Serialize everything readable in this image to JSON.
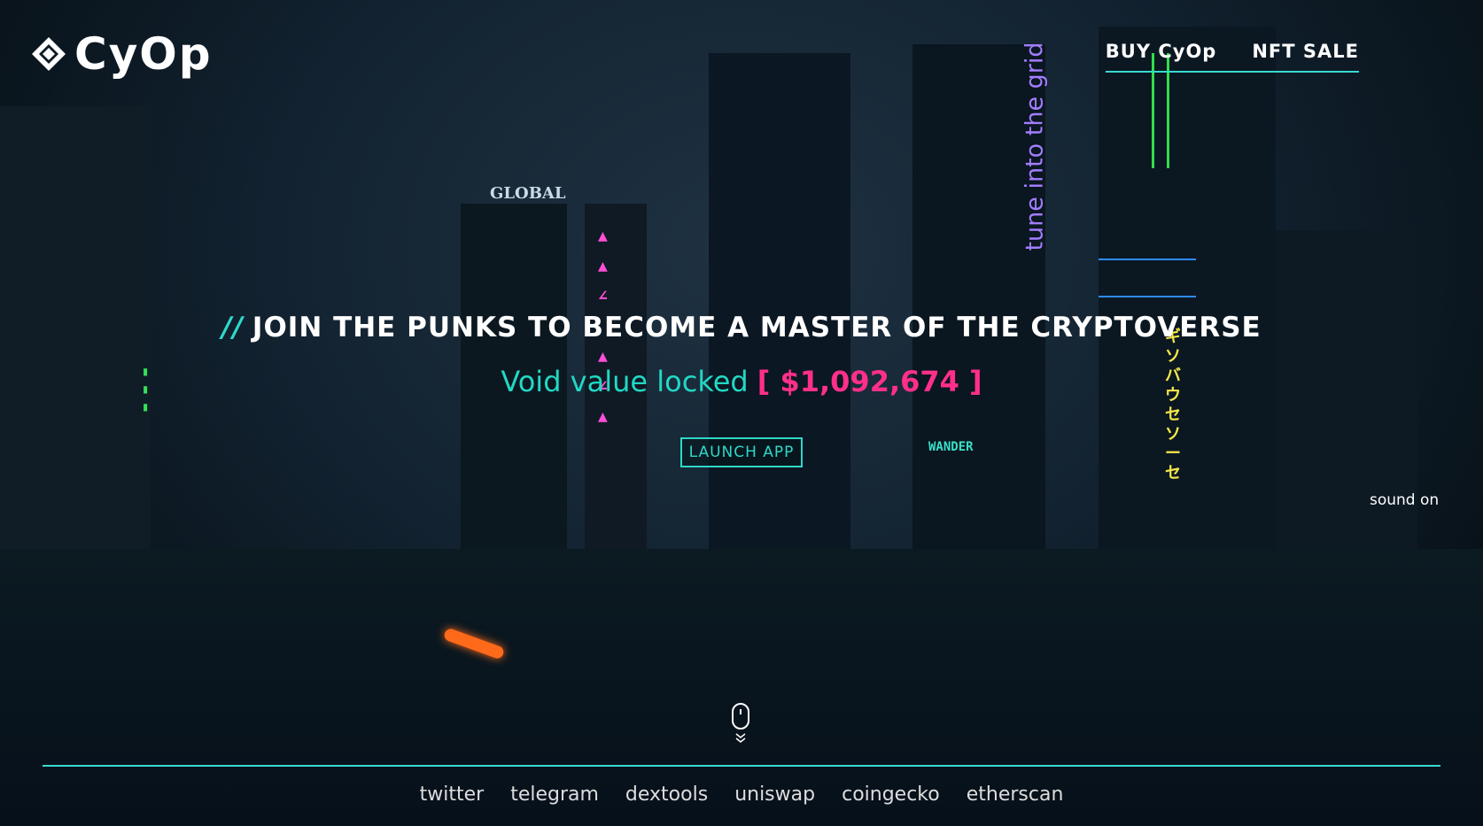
{
  "brand": {
    "name": "CyOp",
    "logo_icon": "diamond-logo-icon"
  },
  "nav": {
    "buy_label": "BUY CyOp",
    "nft_label": "NFT SALE"
  },
  "hero": {
    "headline_prefix": "//",
    "headline": "JOIN THE PUNKS TO BECOME A MASTER OF THE CRYPTOVERSE",
    "tvl_label": "Void value locked",
    "tvl_value": "[ $1,092,674 ]",
    "launch_label": "LAUNCH APP"
  },
  "scene": {
    "vertical_sign": "tune into the grid",
    "global_sign": "GLOBAL",
    "wander_sign": "WANDER"
  },
  "sound_label": "sound on",
  "scroll_icon": "mouse-scroll-icon",
  "footer": {
    "links": [
      "twitter",
      "telegram",
      "dextools",
      "uniswap",
      "coingecko",
      "etherscan"
    ]
  },
  "colors": {
    "accent": "#38d9cf",
    "value": "#ff2f8a"
  }
}
